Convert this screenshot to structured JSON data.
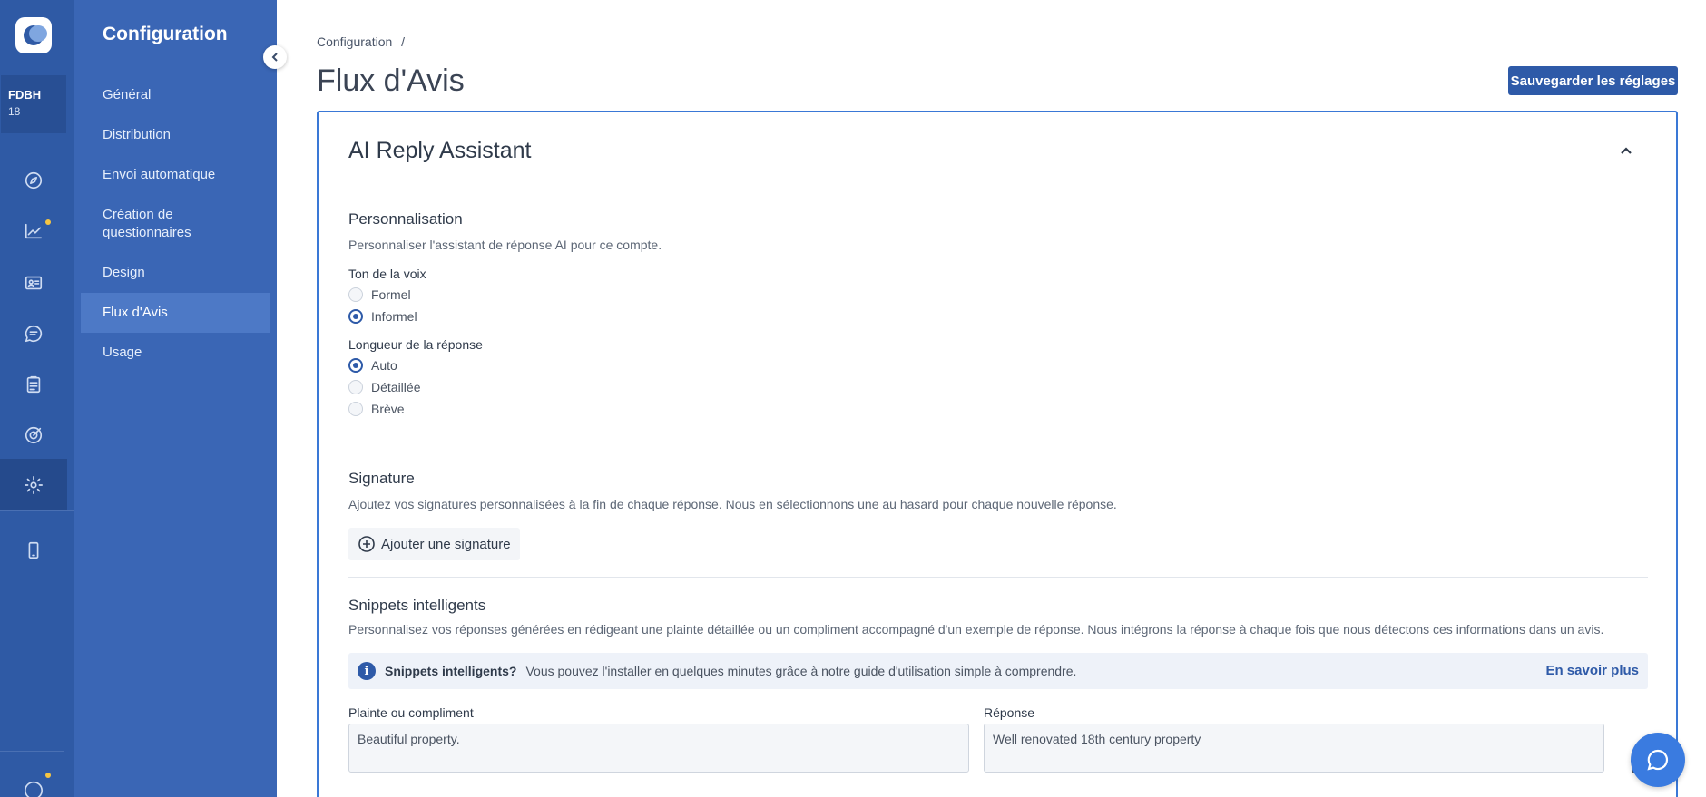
{
  "account": {
    "name": "FDBH",
    "number": "18"
  },
  "nav": {
    "title": "Configuration",
    "items": [
      {
        "label": "Général"
      },
      {
        "label": "Distribution"
      },
      {
        "label": "Envoi automatique"
      },
      {
        "label": "Création de questionnaires"
      },
      {
        "label": "Design"
      },
      {
        "label": "Flux d'Avis",
        "active": true
      },
      {
        "label": "Usage"
      }
    ]
  },
  "rail_icons": [
    "compass-icon",
    "trending-chart-icon",
    "contact-card-icon",
    "chat-icon",
    "clipboard-icon",
    "target-icon",
    "gear-icon",
    "mobile-icon",
    "logo-ring-icon"
  ],
  "breadcrumb": {
    "root": "Configuration",
    "separator": "/"
  },
  "page": {
    "title": "Flux d'Avis",
    "save_label": "Sauvegarder les réglages"
  },
  "card": {
    "title": "AI Reply Assistant",
    "personalisation": {
      "title": "Personnalisation",
      "desc": "Personnaliser l'assistant de réponse AI pour ce compte.",
      "tone": {
        "label": "Ton de la voix",
        "options": [
          {
            "label": "Formel",
            "checked": false
          },
          {
            "label": "Informel",
            "checked": true
          }
        ]
      },
      "length": {
        "label": "Longueur de la réponse",
        "options": [
          {
            "label": "Auto",
            "checked": true
          },
          {
            "label": "Détaillée",
            "checked": false
          },
          {
            "label": "Brève",
            "checked": false
          }
        ]
      }
    },
    "signature": {
      "title": "Signature",
      "desc": "Ajoutez vos signatures personnalisées à la fin de chaque réponse. Nous en sélectionnons une au hasard pour chaque nouvelle réponse.",
      "add_label": "Ajouter une signature"
    },
    "snippets": {
      "title": "Snippets intelligents",
      "desc": "Personnalisez vos réponses générées en rédigeant une plainte détaillée ou un compliment accompagné d'un exemple de réponse. Nous intégrons la réponse à chaque fois que nous détectons ces informations dans un avis.",
      "info_strong": "Snippets intelligents?",
      "info_text": "Vous pouvez l'installer en quelques minutes grâce à notre guide d'utilisation simple à comprendre.",
      "info_link": "En savoir plus",
      "col1_label": "Plainte ou compliment",
      "col2_label": "Réponse",
      "row1": {
        "complaint": "Beautiful property.",
        "response": "Well renovated 18th century property"
      }
    }
  },
  "colors": {
    "rail": "#2f5aa5",
    "nav": "#3a66b5",
    "accent": "#2e5aa8",
    "card_border": "#3a78d6"
  }
}
